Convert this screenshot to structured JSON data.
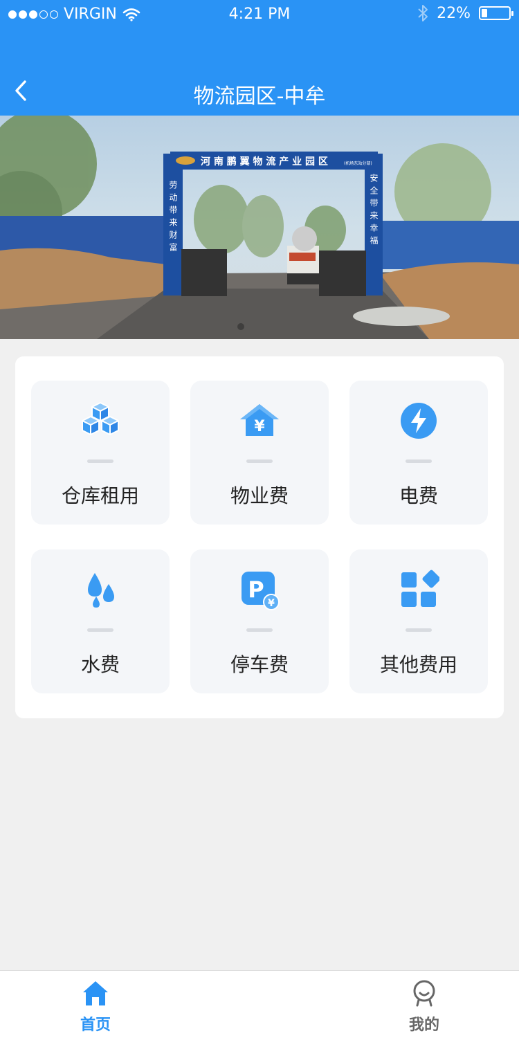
{
  "status_bar": {
    "carrier": "VIRGIN",
    "time": "4:21 PM",
    "battery": "22%",
    "battery_level": 0.22
  },
  "nav": {
    "title": "物流园区-中牟",
    "back_icon": "chevron-left-icon"
  },
  "banner": {
    "gate_sign": "河 南 鹏 翼 物 流 产 业 园 区",
    "gate_sign_small": "(机场东站分部)",
    "left_slogan": "劳动带来财富",
    "right_slogan": "安全带来幸福",
    "active_slide": 1,
    "slide_count": 1
  },
  "services": [
    {
      "label": "仓库租用",
      "icon": "cubes-icon"
    },
    {
      "label": "物业费",
      "icon": "house-yuan-icon"
    },
    {
      "label": "电费",
      "icon": "lightning-icon"
    },
    {
      "label": "水费",
      "icon": "water-drops-icon"
    },
    {
      "label": "停车费",
      "icon": "parking-yuan-icon"
    },
    {
      "label": "其他费用",
      "icon": "apps-grid-icon"
    }
  ],
  "tabbar": {
    "tabs": [
      {
        "label": "首页",
        "icon": "home-icon",
        "active": true
      },
      {
        "label": "我的",
        "icon": "profile-icon",
        "active": false
      }
    ]
  },
  "colors": {
    "primary": "#2a93f5",
    "icon_blue": "#3a9bf3",
    "tile_bg": "#f4f6f9",
    "inactive": "#666666"
  }
}
